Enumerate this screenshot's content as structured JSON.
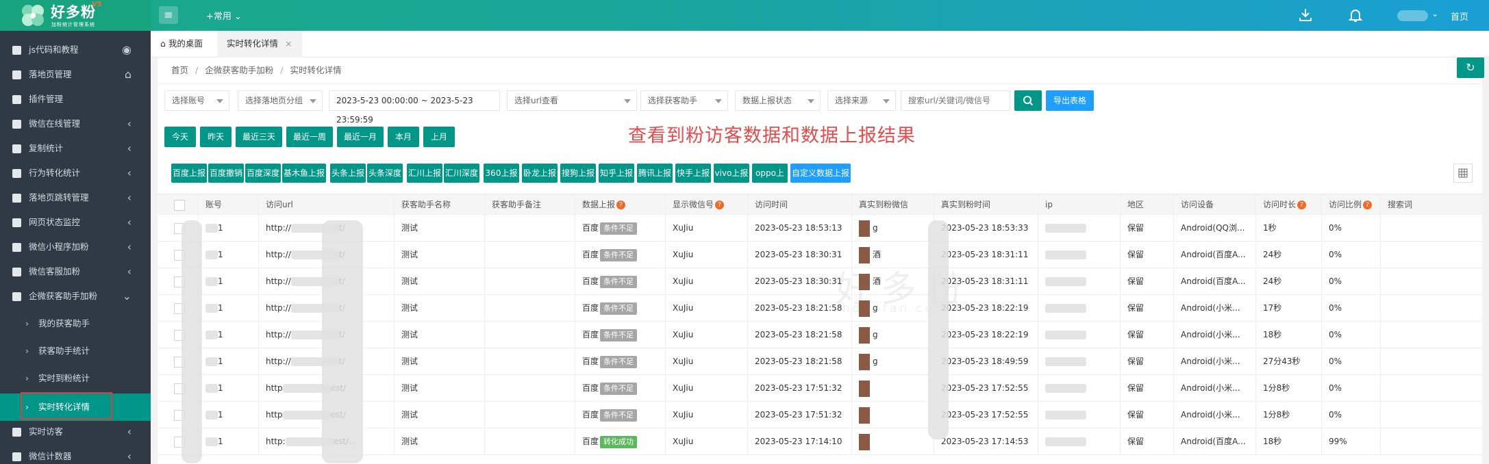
{
  "brand": {
    "title": "好多粉",
    "version": "V5",
    "subtitle": "加粉统计管理系统"
  },
  "header": {
    "common_label": "+常用",
    "home_label": "首页"
  },
  "sidebar": {
    "items": [
      {
        "label": "js代码和教程"
      },
      {
        "label": "落地页管理"
      },
      {
        "label": "插件管理"
      },
      {
        "label": "微信在线管理"
      },
      {
        "label": "复制统计"
      },
      {
        "label": "行为转化统计"
      },
      {
        "label": "落地页跳转管理"
      },
      {
        "label": "网页状态监控"
      },
      {
        "label": "微信小程序加粉"
      },
      {
        "label": "微信客服加粉"
      },
      {
        "label": "企微获客助手加粉"
      },
      {
        "label": "我的获客助手"
      },
      {
        "label": "获客助手统计"
      },
      {
        "label": "实时到粉统计"
      },
      {
        "label": "实时转化详情"
      },
      {
        "label": "实时访客"
      },
      {
        "label": "微信计数器"
      }
    ]
  },
  "tabs": [
    {
      "label": "我的桌面"
    },
    {
      "label": "实时转化详情"
    }
  ],
  "breadcrumb": [
    "首页",
    "企微获客助手加粉",
    "实时转化详情"
  ],
  "filters": {
    "account": "选择账号",
    "landing_group": "选择落地页分组",
    "date_range": "2023-5-23 00:00:00 ~ 2023-5-23 23:59:59",
    "url": "选择url查看",
    "assistant": "选择获客助手",
    "report_status": "数据上报状态",
    "source": "选择来源",
    "search_placeholder": "搜索url/关键词/微信号",
    "export_label": "导出表格"
  },
  "quick_dates": [
    "今天",
    "昨天",
    "最近三天",
    "最近一周",
    "最近一月",
    "本月",
    "上月"
  ],
  "headline": "查看到粉访客数据和数据上报结果",
  "platform_buttons": [
    "百度上报",
    "百度撤销",
    "百度深度",
    "基木鱼上报",
    "头条上报",
    "头条深度",
    "汇川上报",
    "汇川深度",
    "360上报",
    "卧龙上报",
    "搜狗上报",
    "知乎上报",
    "腾讯上报",
    "快手上报",
    "vivo上报",
    "oppo上报",
    "自定义数据上报"
  ],
  "watermark": {
    "main": "好多粉",
    "sub": "hduofan.com"
  },
  "table": {
    "columns": [
      "账号",
      "访问url",
      "获客助手名称",
      "获客助手备注",
      "数据上报",
      "显示微信号",
      "访问时间",
      "真实到粉微信",
      "真实到粉时间",
      "ip",
      "地区",
      "访问设备",
      "访问时长",
      "访问比例",
      "搜索词"
    ],
    "rows": [
      {
        "account": "1",
        "url": "http://",
        "url_tail": "t/",
        "assistant": "测试",
        "report_platform": "百度",
        "report_status": "条件不足",
        "wechat": "XuJiu",
        "visit_time": "2023-05-23 18:53:13",
        "fan_wechat": "g",
        "fan_time": "2023-05-23 18:53:33",
        "region": "保留",
        "device": "Android(QQ浏...",
        "duration": "1秒",
        "ratio": "0%"
      },
      {
        "account": "1",
        "url": "http://",
        "url_tail": "t/",
        "assistant": "测试",
        "report_platform": "百度",
        "report_status": "条件不足",
        "wechat": "XuJiu",
        "visit_time": "2023-05-23 18:30:31",
        "fan_wechat": "酒",
        "fan_time": "2023-05-23 18:31:11",
        "region": "保留",
        "device": "Android(百度A...",
        "duration": "24秒",
        "ratio": "0%"
      },
      {
        "account": "1",
        "url": "http://",
        "url_tail": "t/",
        "assistant": "测试",
        "report_platform": "百度",
        "report_status": "条件不足",
        "wechat": "XuJiu",
        "visit_time": "2023-05-23 18:30:31",
        "fan_wechat": "酒",
        "fan_time": "2023-05-23 18:31:11",
        "region": "保留",
        "device": "Android(百度A...",
        "duration": "24秒",
        "ratio": "0%"
      },
      {
        "account": "1",
        "url": "http://",
        "url_tail": "t/",
        "assistant": "测试",
        "report_platform": "百度",
        "report_status": "条件不足",
        "wechat": "XuJiu",
        "visit_time": "2023-05-23 18:21:58",
        "fan_wechat": "g",
        "fan_time": "2023-05-23 18:22:19",
        "region": "保留",
        "device": "Android(小米...",
        "duration": "17秒",
        "ratio": "0%"
      },
      {
        "account": "1",
        "url": "http://",
        "url_tail": "t/",
        "assistant": "测试",
        "report_platform": "百度",
        "report_status": "条件不足",
        "wechat": "XuJiu",
        "visit_time": "2023-05-23 18:21:58",
        "fan_wechat": "g",
        "fan_time": "2023-05-23 18:22:19",
        "region": "保留",
        "device": "Android(小米...",
        "duration": "18秒",
        "ratio": "0%"
      },
      {
        "account": "1",
        "url": "http://",
        "url_tail": "t/",
        "assistant": "测试",
        "report_platform": "百度",
        "report_status": "条件不足",
        "wechat": "XuJiu",
        "visit_time": "2023-05-23 18:21:58",
        "fan_wechat": "g",
        "fan_time": "2023-05-23 18:49:59",
        "region": "保留",
        "device": "Android(小米...",
        "duration": "27分43秒",
        "ratio": "0%"
      },
      {
        "account": "1",
        "url": "http",
        "url_tail": "est/",
        "assistant": "测试",
        "report_platform": "百度",
        "report_status": "条件不足",
        "wechat": "XuJiu",
        "visit_time": "2023-05-23 17:51:32",
        "fan_wechat": "",
        "fan_time": "2023-05-23 17:52:55",
        "region": "保留",
        "device": "Android(小米...",
        "duration": "1分8秒",
        "ratio": "0%"
      },
      {
        "account": "1",
        "url": "http",
        "url_tail": "est/",
        "assistant": "测试",
        "report_platform": "百度",
        "report_status": "条件不足",
        "wechat": "XuJiu",
        "visit_time": "2023-05-23 17:51:32",
        "fan_wechat": "",
        "fan_time": "2023-05-23 17:52:55",
        "region": "保留",
        "device": "Android(小米...",
        "duration": "1分8秒",
        "ratio": "0%"
      },
      {
        "account": "1",
        "url": "http:",
        "url_tail": "est/...",
        "assistant": "测试",
        "report_platform": "百度",
        "report_status": "转化成功",
        "wechat": "XuJiu",
        "visit_time": "2023-05-23 17:14:10",
        "fan_wechat": "",
        "fan_time": "2023-05-23 17:14:53",
        "region": "保留",
        "device": "Android(百度A...",
        "duration": "18秒",
        "ratio": "99%"
      }
    ]
  },
  "colors": {
    "primary": "#009688",
    "blue": "#1e9fff",
    "sidebar": "#2f3a45",
    "headline": "#e54b4b",
    "tag_ok": "#5cb85c",
    "tag_gray": "#a6a6a6"
  }
}
